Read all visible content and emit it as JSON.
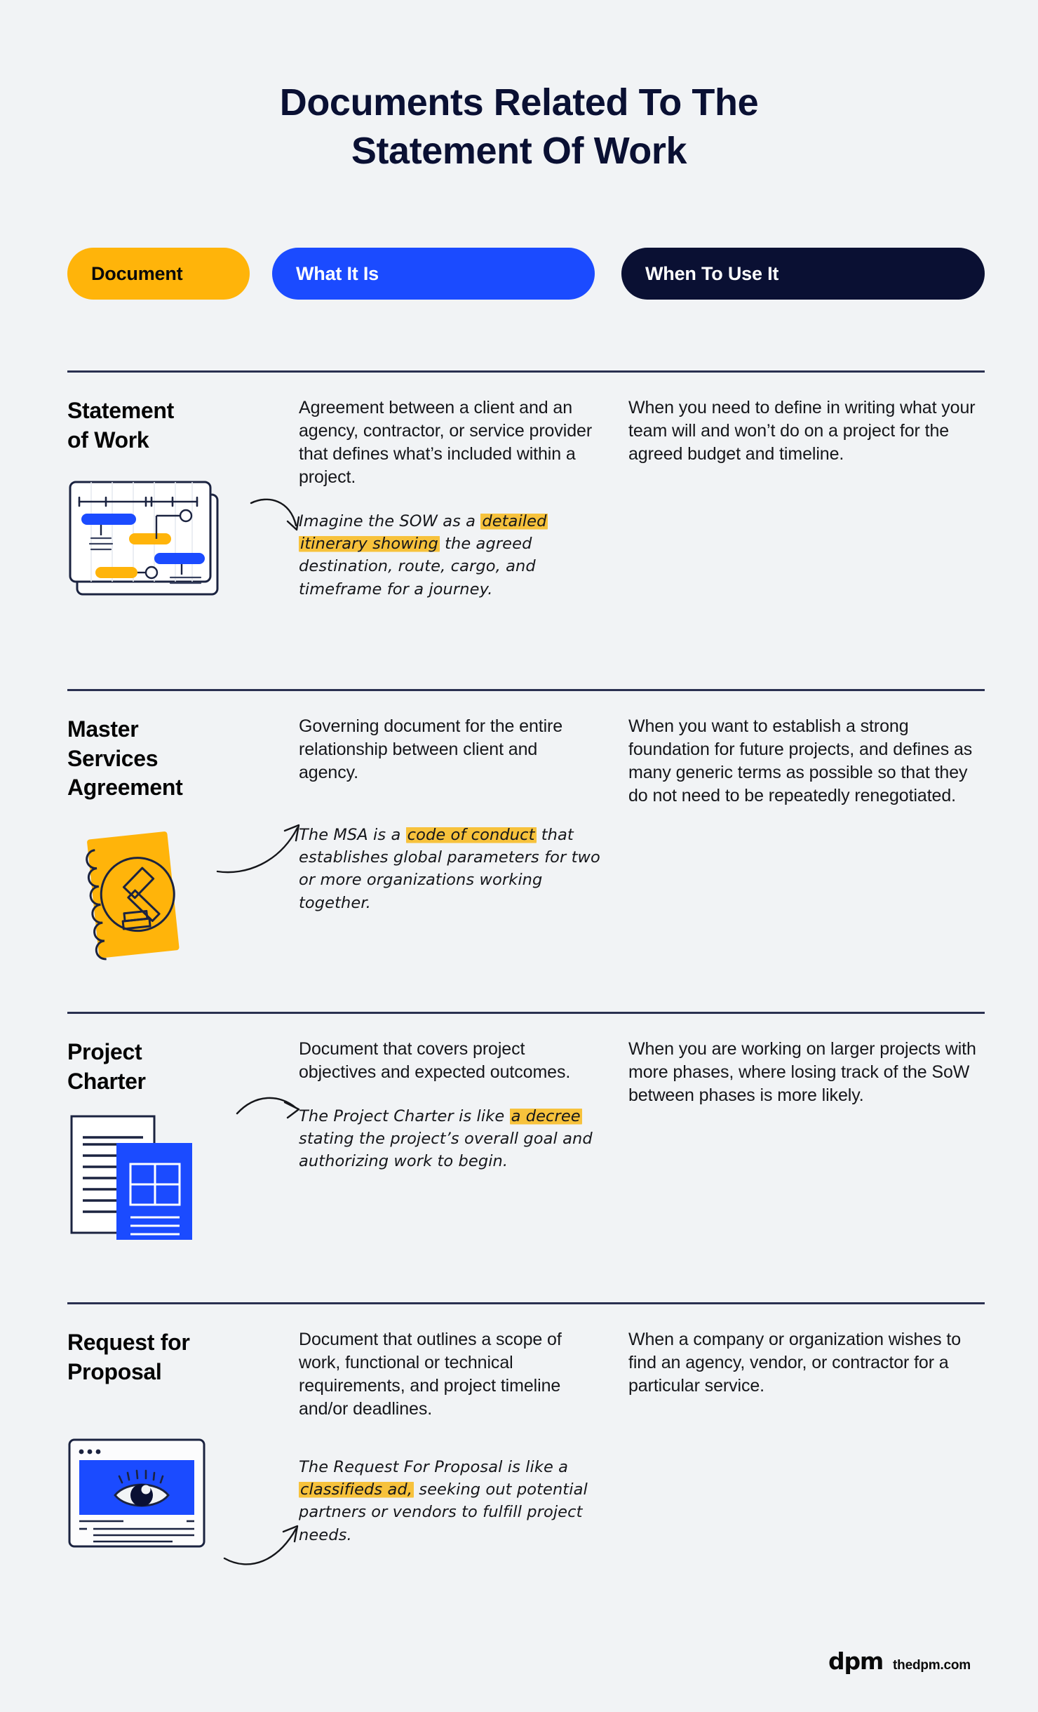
{
  "theme": {
    "background": "#f1f3f5",
    "yellow": "#ffb40a",
    "blue": "#1b4bff",
    "navy": "#0a1033",
    "highlight": "#f7c23c",
    "text": "#15161a"
  },
  "title": {
    "line1": "Documents Related To The",
    "line2": "Statement Of Work"
  },
  "header_pills": {
    "document": "Document",
    "what_it_is": "What It Is",
    "when_to_use_it": "When To Use It"
  },
  "rows": [
    {
      "name": "Statement of Work",
      "title_line1": "Statement",
      "title_line2": "of Work",
      "what_it_is": "Agreement between a client and an agency, contractor, or service provider that defines what’s included within a project.",
      "note": {
        "parts": [
          {
            "text": "Imagine the SOW as a ",
            "highlight": false
          },
          {
            "text": "detailed itinerary showing",
            "highlight": true
          },
          {
            "text": " the agreed destination, route, cargo, and timeframe for a journey.",
            "highlight": false
          }
        ]
      },
      "when_to_use_it": "When you need to define in writing what your team will and won’t do on a project for the agreed budget and timeline.",
      "icon": "gantt-chart-icon"
    },
    {
      "name": "Master Services Agreement",
      "title_line1": "Master",
      "title_line2": "Services",
      "title_line3": "Agreement",
      "what_it_is": "Governing document for the entire relationship between client and agency.",
      "note": {
        "parts": [
          {
            "text": "The MSA is a ",
            "highlight": false
          },
          {
            "text": "code of conduct",
            "highlight": true
          },
          {
            "text": " that establishes global parameters for two or more organizations working together.",
            "highlight": false
          }
        ]
      },
      "when_to_use_it": "When you want to establish a strong foundation for future projects, and defines as many generic terms as possible so that they do not need to be repeatedly renegotiated.",
      "icon": "notebook-gavel-icon"
    },
    {
      "name": "Project Charter",
      "title_line1": "Project",
      "title_line2": "Charter",
      "what_it_is": "Document that covers project objectives and expected outcomes.",
      "note": {
        "parts": [
          {
            "text": "The Project Charter is like ",
            "highlight": false
          },
          {
            "text": "a decree",
            "highlight": true
          },
          {
            "text": " stating the project’s overall goal and authorizing work to begin.",
            "highlight": false
          }
        ]
      },
      "when_to_use_it": "When you are working on larger projects with more phases, where losing track of the SoW between phases is more likely.",
      "icon": "documents-grid-icon"
    },
    {
      "name": "Request for Proposal",
      "title_line1": "Request for",
      "title_line2": "Proposal",
      "what_it_is": "Document that outlines a scope of work, functional or technical requirements, and project timeline and/or deadlines.",
      "note": {
        "parts": [
          {
            "text": "The Request For Proposal is like a ",
            "highlight": false
          },
          {
            "text": "classifieds ad,",
            "highlight": true
          },
          {
            "text": " seeking out potential partners or vendors to fulfill project needs.",
            "highlight": false
          }
        ]
      },
      "when_to_use_it": "When a company or organization wishes to find an agency, vendor, or contractor for a particular service.",
      "icon": "browser-eye-icon"
    }
  ],
  "footer": {
    "logo": "dpm",
    "url": "thedpm.com"
  }
}
